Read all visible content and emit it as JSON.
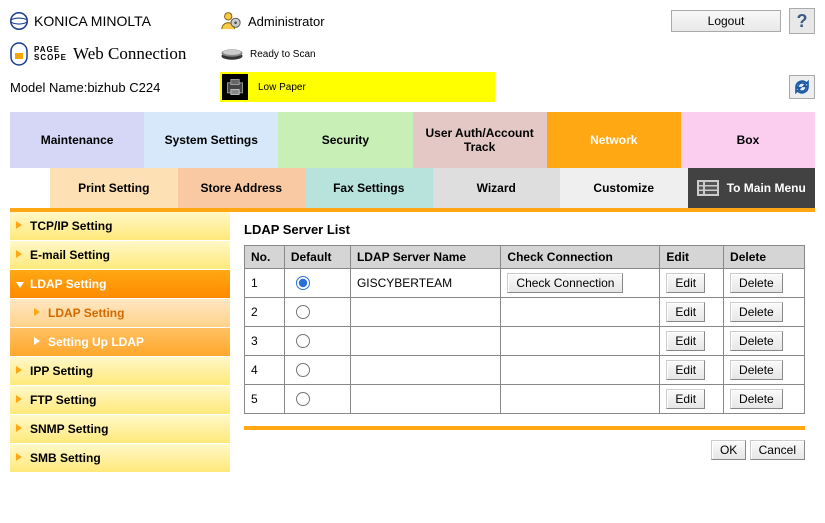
{
  "brand": "KONICA MINOLTA",
  "pagescope": {
    "line1": "PAGE",
    "line2": "SCOPE",
    "product": "Web Connection"
  },
  "model_label": "Model Name:",
  "model_name": "bizhub C224",
  "user_role": "Administrator",
  "logout": "Logout",
  "help": "?",
  "status_ready": "Ready to Scan",
  "status_paper": "Low Paper",
  "tabs_row1": {
    "maintenance": "Maintenance",
    "system": "System Settings",
    "security": "Security",
    "user": "User Auth/Account Track",
    "network": "Network",
    "box": "Box"
  },
  "tabs_row2": {
    "print": "Print Setting",
    "store": "Store Address",
    "fax": "Fax Settings",
    "wizard": "Wizard",
    "customize": "Customize",
    "to_main": "To Main Menu"
  },
  "sidebar": [
    {
      "key": "tcpip",
      "label": "TCP/IP Setting"
    },
    {
      "key": "email",
      "label": "E-mail Setting"
    },
    {
      "key": "ldap",
      "label": "LDAP Setting",
      "active": true
    },
    {
      "key": "ldap_sub1",
      "label": "LDAP Setting",
      "sub": "a"
    },
    {
      "key": "ldap_sub2",
      "label": "Setting Up LDAP",
      "sub": "b"
    },
    {
      "key": "ipp",
      "label": "IPP Setting"
    },
    {
      "key": "ftp",
      "label": "FTP Setting"
    },
    {
      "key": "snmp",
      "label": "SNMP Setting"
    },
    {
      "key": "smb",
      "label": "SMB Setting"
    }
  ],
  "main_title": "LDAP Server List",
  "table": {
    "headers": {
      "no": "No.",
      "default": "Default",
      "name": "LDAP Server Name",
      "check": "Check Connection",
      "edit": "Edit",
      "delete": "Delete"
    },
    "check_btn": "Check Connection",
    "edit_btn": "Edit",
    "delete_btn": "Delete",
    "rows": [
      {
        "no": "1",
        "default": true,
        "name": "GISCYBERTEAM",
        "check": true
      },
      {
        "no": "2",
        "default": false,
        "name": "",
        "check": false
      },
      {
        "no": "3",
        "default": false,
        "name": "",
        "check": false
      },
      {
        "no": "4",
        "default": false,
        "name": "",
        "check": false
      },
      {
        "no": "5",
        "default": false,
        "name": "",
        "check": false
      }
    ]
  },
  "footer": {
    "ok": "OK",
    "cancel": "Cancel"
  }
}
